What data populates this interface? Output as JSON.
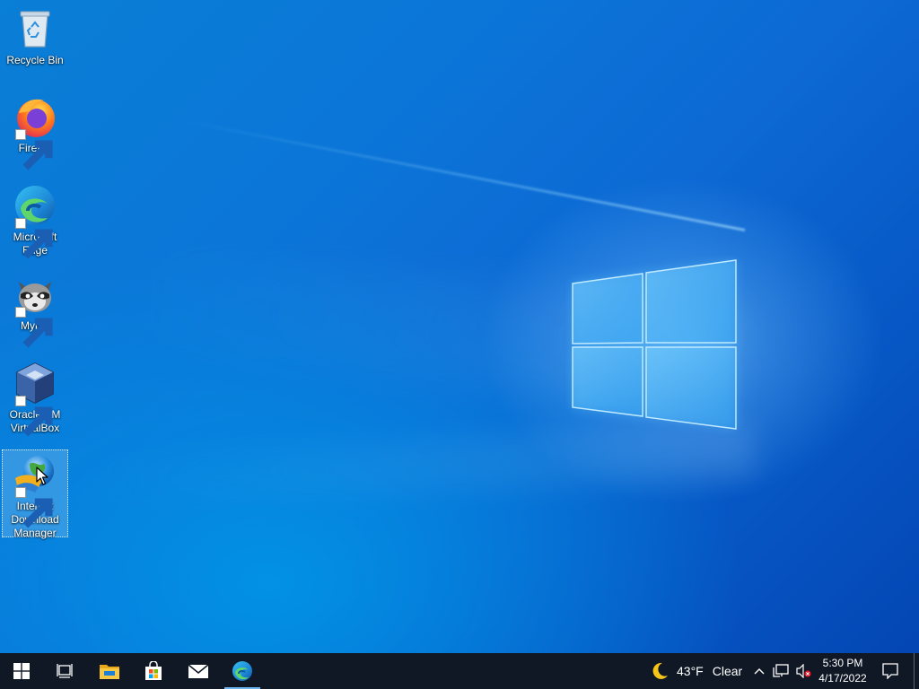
{
  "desktop": {
    "icons": [
      {
        "label": "Recycle Bin",
        "icon": "recycle-bin-icon",
        "shortcut": false,
        "selected": false
      },
      {
        "label": "Firefox",
        "icon": "firefox-icon",
        "shortcut": true,
        "selected": false
      },
      {
        "label": "Microsoft\nEdge",
        "icon": "edge-icon",
        "shortcut": true,
        "selected": false
      },
      {
        "label": "Mypal",
        "icon": "mypal-raccoon-icon",
        "shortcut": true,
        "selected": false
      },
      {
        "label": "Oracle VM\nVirtualBox",
        "icon": "virtualbox-icon",
        "shortcut": true,
        "selected": false
      },
      {
        "label": "Internet\nDownload\nManager",
        "icon": "idm-globe-icon",
        "shortcut": true,
        "selected": true
      }
    ],
    "wallpaper": "windows-10-logo-light-blue",
    "colors": {
      "wallpaper_dark": "#0446b3",
      "wallpaper_light": "#0a7fd6",
      "logo_glow": "#7ccfff"
    }
  },
  "taskbar": {
    "start": "windows-start-icon",
    "task_view": "task-view-icon",
    "pinned": [
      {
        "name": "file-explorer",
        "icon": "folder-icon",
        "active": false
      },
      {
        "name": "microsoft-store",
        "icon": "store-bag-icon",
        "active": false
      },
      {
        "name": "mail",
        "icon": "mail-envelope-icon",
        "active": false
      },
      {
        "name": "microsoft-edge",
        "icon": "edge-icon",
        "active": true
      }
    ],
    "weather": {
      "icon": "moon-icon",
      "temperature": "43°F",
      "condition": "Clear"
    },
    "tray": [
      "chevron-up-icon",
      "network-icon",
      "volume-muted-icon"
    ],
    "clock": {
      "time": "5:30 PM",
      "date": "4/17/2022"
    },
    "notifications": "action-center-icon",
    "colors": {
      "background": "#101826",
      "active_indicator": "#6fb3ef"
    }
  }
}
